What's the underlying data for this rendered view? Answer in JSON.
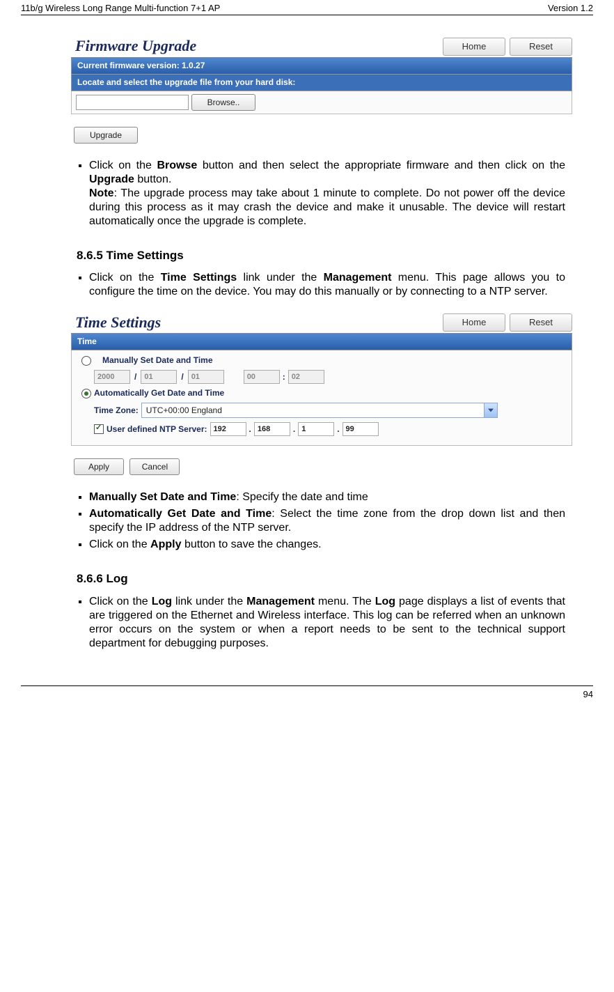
{
  "header": {
    "left": "11b/g Wireless Long Range Multi-function 7+1 AP",
    "right": "Version 1.2"
  },
  "footer": {
    "page": "94"
  },
  "firmware_panel": {
    "title": "Firmware Upgrade",
    "home": "Home",
    "reset": "Reset",
    "version_bar": "Current firmware version: 1.0.27",
    "locate_bar": "Locate and select the upgrade file from your hard disk:",
    "browse": "Browse..",
    "upgrade": "Upgrade"
  },
  "bullets_fw": {
    "b1a": "Click on the ",
    "b1b": "Browse",
    "b1c": " button and then select the appropriate firmware and then click on the ",
    "b1d": "Upgrade",
    "b1e": " button.",
    "note_label": "Note",
    "note_body": ": The upgrade process may take about 1 minute to complete. Do not power off the device during this process as it may crash the device and make it unusable. The device will restart automatically once the upgrade is complete."
  },
  "section_time": "8.6.5   Time Settings",
  "bullets_time_intro": {
    "a": "Click on the ",
    "b": "Time Settings",
    "c": " link under the ",
    "d": "Management",
    "e": " menu. This page allows you to configure the time on the device. You may do this manually or by connecting to a NTP server."
  },
  "time_panel": {
    "title": "Time Settings",
    "home": "Home",
    "reset": "Reset",
    "bar": "Time",
    "manual_label": "Manually Set Date and Time",
    "auto_label": "Automatically Get Date and Time",
    "tz_label": "Time Zone:",
    "tz_value": "UTC+00:00 England",
    "ntp_label": "User defined NTP Server:",
    "year": "2000",
    "m1": "01",
    "m2": "01",
    "h": "00",
    "mm": "02",
    "ip1": "192",
    "ip2": "168",
    "ip3": "1",
    "ip4": "99",
    "apply": "Apply",
    "cancel": "Cancel"
  },
  "bullets_time": {
    "b1a": "Manually Set Date and Time",
    "b1b": ": Specify the date and time",
    "b2a": "Automatically Get Date and Time",
    "b2b": ": Select the time zone from the drop down list and then specify the IP address of the NTP server.",
    "b3a": "Click on the ",
    "b3b": "Apply",
    "b3c": " button to save the changes."
  },
  "section_log": "8.6.6   Log",
  "bullets_log": {
    "a": "Click on the ",
    "b": "Log",
    "c": " link under the ",
    "d": "Management",
    "e": " menu. The ",
    "f": "Log",
    "g": " page displays a list of events that are triggered on the Ethernet and Wireless interface. This log can be referred when an unknown error occurs on the system or when a report needs to be sent to the technical support department for debugging purposes."
  }
}
